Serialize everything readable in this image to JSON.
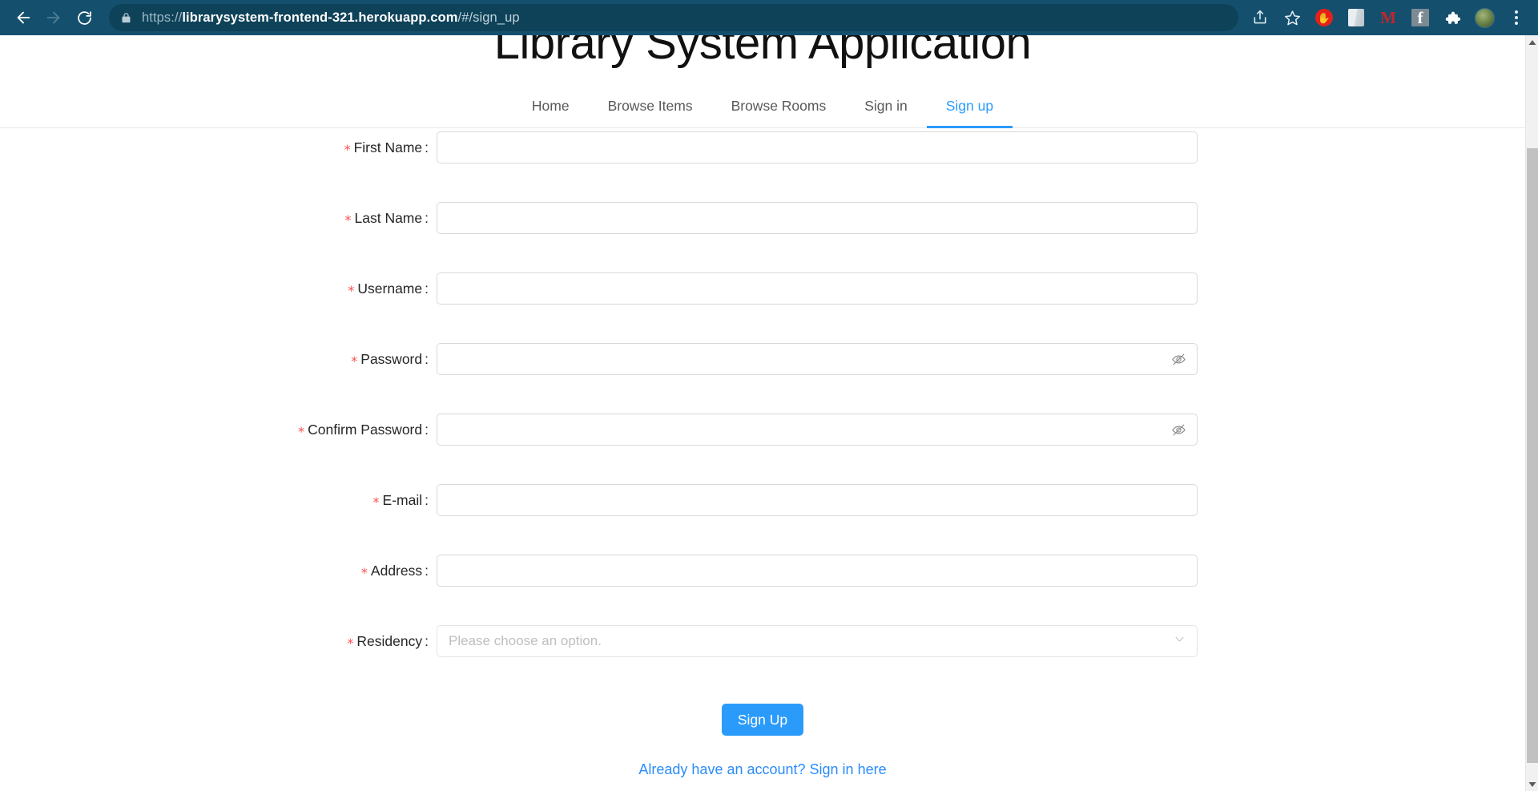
{
  "browser": {
    "back_icon": "arrow-left-icon",
    "forward_icon": "arrow-right-icon",
    "reload_icon": "reload-icon",
    "lock_icon": "lock-icon",
    "url_scheme": "https://",
    "url_domain": "librarysystem-frontend-321.herokuapp.com",
    "url_path": "/#/sign_up",
    "full_url": "https://librarysystem-frontend-321.herokuapp.com/#/sign_up",
    "toolbar_bg": "#14506e",
    "extensions": [
      {
        "name": "share-icon",
        "label": ""
      },
      {
        "name": "bookmark-star-icon",
        "label": ""
      },
      {
        "name": "adblock-extension-icon",
        "label": "",
        "color": "#e32119"
      },
      {
        "name": "office-extension-icon",
        "label": ""
      },
      {
        "name": "mendeley-extension-icon",
        "label": "M",
        "color": "#c0272d"
      },
      {
        "name": "facebook-extension-icon",
        "label": "f"
      },
      {
        "name": "extensions-puzzle-icon",
        "label": ""
      },
      {
        "name": "profile-avatar",
        "label": ""
      },
      {
        "name": "chrome-menu-icon",
        "label": ""
      }
    ]
  },
  "page": {
    "title": "Library System Application",
    "nav": [
      {
        "label": "Home",
        "active": false
      },
      {
        "label": "Browse Items",
        "active": false
      },
      {
        "label": "Browse Rooms",
        "active": false
      },
      {
        "label": "Sign in",
        "active": false
      },
      {
        "label": "Sign up",
        "active": true
      }
    ],
    "accent_color": "#2b9bfb",
    "required_marker": "*",
    "required_color": "#ff4d4f",
    "colon": ":"
  },
  "form": {
    "fields": [
      {
        "label": "First Name",
        "value": "",
        "placeholder": "",
        "type": "text",
        "name": "first-name"
      },
      {
        "label": "Last Name",
        "value": "",
        "placeholder": "",
        "type": "text",
        "name": "last-name"
      },
      {
        "label": "Username",
        "value": "",
        "placeholder": "",
        "type": "text",
        "name": "username"
      },
      {
        "label": "Password",
        "value": "",
        "placeholder": "",
        "type": "password",
        "name": "password"
      },
      {
        "label": "Confirm Password",
        "value": "",
        "placeholder": "",
        "type": "password",
        "name": "confirm-password"
      },
      {
        "label": "E-mail",
        "value": "",
        "placeholder": "",
        "type": "text",
        "name": "email"
      },
      {
        "label": "Address",
        "value": "",
        "placeholder": "",
        "type": "text",
        "name": "address"
      }
    ],
    "residency": {
      "label": "Residency",
      "placeholder": "Please choose an option.",
      "value": "",
      "chevron_icon": "chevron-down-icon"
    },
    "eye_icon": "eye-off-icon",
    "submit_label": "Sign Up",
    "signin_link_text": "Already have an account? Sign in here"
  },
  "scrollbar": {
    "up_arrow_icon": "caret-up-icon",
    "down_arrow_icon": "caret-down-icon",
    "thumb_color": "#c1c1c1",
    "track_color": "#f1f1f1"
  }
}
